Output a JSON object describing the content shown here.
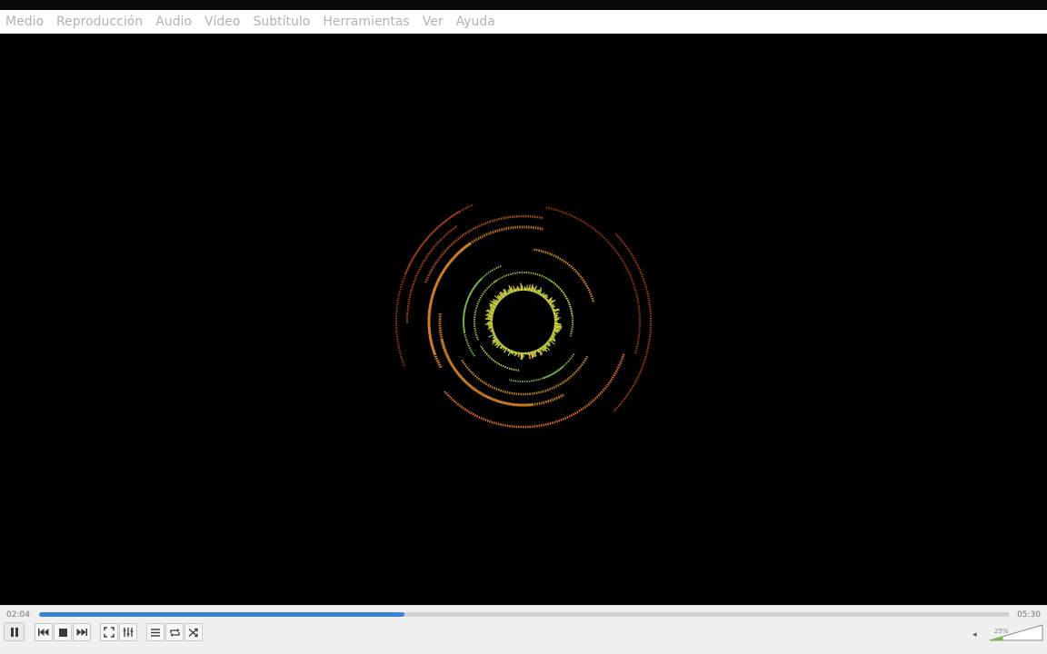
{
  "menu": {
    "items": [
      "Medio",
      "Reproducción",
      "Audio",
      "Vídeo",
      "Subtítulo",
      "Herramientas",
      "Ver",
      "Ayuda"
    ]
  },
  "player": {
    "elapsed": "02:04",
    "total": "05:30",
    "progress_fraction": 0.376,
    "volume_label": "25%",
    "volume_fraction": 0.25
  },
  "controls": {
    "play_pause_icon": "pause-icon",
    "buttons": [
      "previous-icon",
      "stop-icon",
      "next-icon",
      "fullscreen-icon",
      "extended-settings-icon",
      "playlist-icon",
      "loop-icon",
      "shuffle-icon"
    ]
  },
  "colors": {
    "seek_fill": "#3a83d6",
    "visual_outer": "#c94a1a",
    "visual_mid": "#f0902a",
    "visual_inner": "#f2d23a",
    "visual_green": "#7fc84a"
  }
}
